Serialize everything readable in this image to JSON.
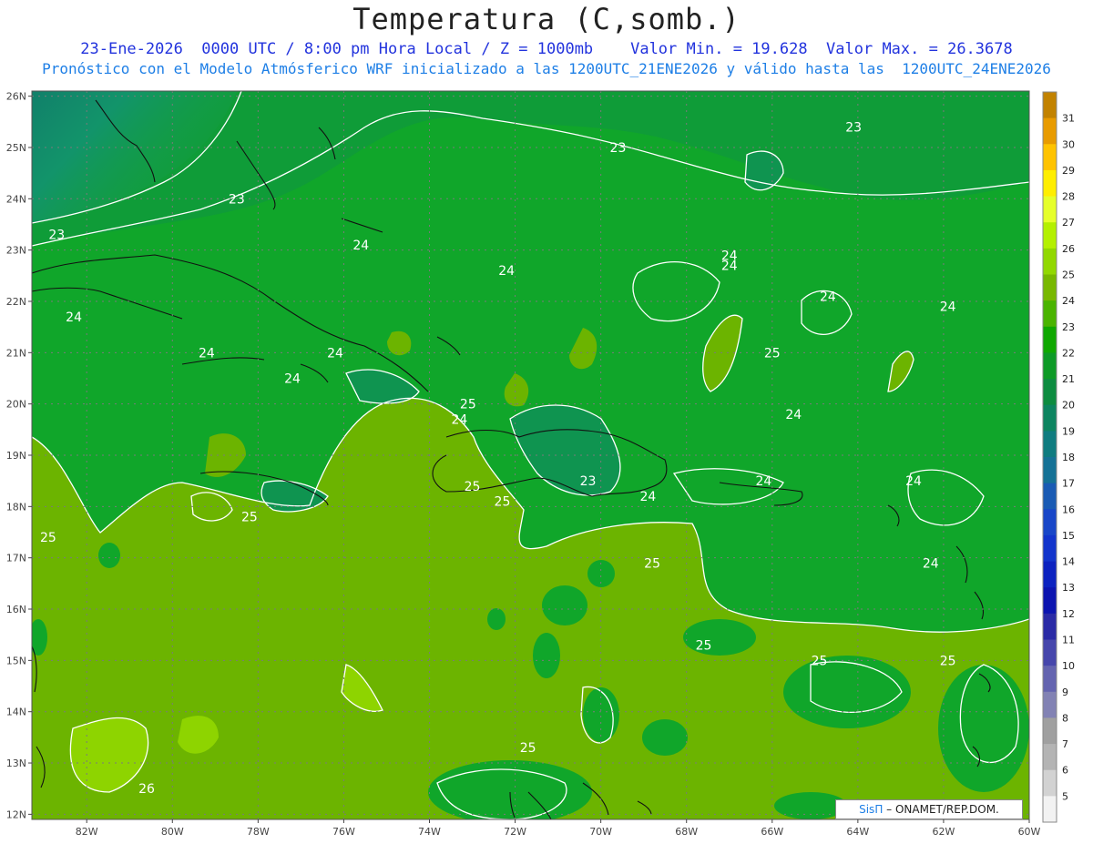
{
  "title": "Temperatura (C,somb.)",
  "subtitle_1": "23-Ene-2026  0000 UTC / 8:00 pm Hora Local / Z = 1000mb    Valor Min. = 19.628  Valor Max. = 26.3678",
  "subtitle_2": "Pronóstico con el Modelo Atmósferico WRF inicializado a las 1200UTC_21ENE2026 y válido hasta las  1200UTC_24ENE2026",
  "credit": {
    "logo": "SisΠ",
    "text": " – ONAMET/REP.DOM."
  },
  "map": {
    "lon_range": [
      -83.28,
      -60
    ],
    "lat_range": [
      11.9,
      26.1
    ],
    "lat_ticks": [
      "12N",
      "13N",
      "14N",
      "15N",
      "16N",
      "17N",
      "18N",
      "19N",
      "20N",
      "21N",
      "22N",
      "23N",
      "24N",
      "25N",
      "26N"
    ],
    "lon_ticks": [
      "82W",
      "80W",
      "78W",
      "76W",
      "74W",
      "72W",
      "70W",
      "68W",
      "66W",
      "64W",
      "62W",
      "60W"
    ],
    "grid": "dotted",
    "contour_labels": [
      {
        "t": "23",
        "lon": -69.6,
        "lat": 25.0
      },
      {
        "t": "23",
        "lon": -64.1,
        "lat": 25.4
      },
      {
        "t": "23",
        "lon": -78.5,
        "lat": 24.0
      },
      {
        "t": "23",
        "lon": -82.7,
        "lat": 23.3
      },
      {
        "t": "24",
        "lon": -75.6,
        "lat": 23.1
      },
      {
        "t": "24",
        "lon": -72.2,
        "lat": 22.6
      },
      {
        "t": "24",
        "lon": -67.0,
        "lat": 22.9
      },
      {
        "t": "24",
        "lon": -67.0,
        "lat": 22.7
      },
      {
        "t": "24",
        "lon": -64.7,
        "lat": 22.1
      },
      {
        "t": "24",
        "lon": -61.9,
        "lat": 21.9
      },
      {
        "t": "24",
        "lon": -82.3,
        "lat": 21.7
      },
      {
        "t": "24",
        "lon": -79.2,
        "lat": 21.0
      },
      {
        "t": "24",
        "lon": -76.2,
        "lat": 21.0
      },
      {
        "t": "25",
        "lon": -66.0,
        "lat": 21.0
      },
      {
        "t": "24",
        "lon": -77.2,
        "lat": 20.5
      },
      {
        "t": "25",
        "lon": -73.1,
        "lat": 20.0
      },
      {
        "t": "24",
        "lon": -73.3,
        "lat": 19.7
      },
      {
        "t": "24",
        "lon": -65.5,
        "lat": 19.8
      },
      {
        "t": "25",
        "lon": -73.0,
        "lat": 18.4
      },
      {
        "t": "23",
        "lon": -70.3,
        "lat": 18.5
      },
      {
        "t": "24",
        "lon": -66.2,
        "lat": 18.5
      },
      {
        "t": "24",
        "lon": -62.7,
        "lat": 18.5
      },
      {
        "t": "25",
        "lon": -72.3,
        "lat": 18.1
      },
      {
        "t": "24",
        "lon": -68.9,
        "lat": 18.2
      },
      {
        "t": "25",
        "lon": -78.2,
        "lat": 17.8
      },
      {
        "t": "25",
        "lon": -82.9,
        "lat": 17.4
      },
      {
        "t": "25",
        "lon": -68.8,
        "lat": 16.9
      },
      {
        "t": "24",
        "lon": -62.3,
        "lat": 16.9
      },
      {
        "t": "25",
        "lon": -67.6,
        "lat": 15.3
      },
      {
        "t": "25",
        "lon": -64.9,
        "lat": 15.0
      },
      {
        "t": "25",
        "lon": -61.9,
        "lat": 15.0
      },
      {
        "t": "25",
        "lon": -71.7,
        "lat": 13.3
      },
      {
        "t": "26",
        "lon": -80.6,
        "lat": 12.5
      }
    ]
  },
  "colorbar": {
    "labels": [
      "31",
      "30",
      "29",
      "28",
      "27",
      "26",
      "25",
      "24",
      "23",
      "22",
      "21",
      "20",
      "19",
      "18",
      "17",
      "16",
      "15",
      "14",
      "13",
      "12",
      "11",
      "10",
      "9",
      "8",
      "7",
      "6",
      "5"
    ],
    "colors": [
      "#c28200",
      "#e89b00",
      "#ffc300",
      "#ffee00",
      "#e6ff2a",
      "#b4f000",
      "#92d800",
      "#78b800",
      "#4ab400",
      "#0fa800",
      "#0d9a26",
      "#0d8c40",
      "#0d8560",
      "#0f7c80",
      "#157296",
      "#1a5bb4",
      "#1846c8",
      "#1234cc",
      "#0c22c0",
      "#0c14b0",
      "#2a2aa6",
      "#4646ac",
      "#6464b0",
      "#8282b4",
      "#a0a0a0",
      "#b4b4b4",
      "#d2d2d2",
      "#f2f2f2"
    ]
  }
}
